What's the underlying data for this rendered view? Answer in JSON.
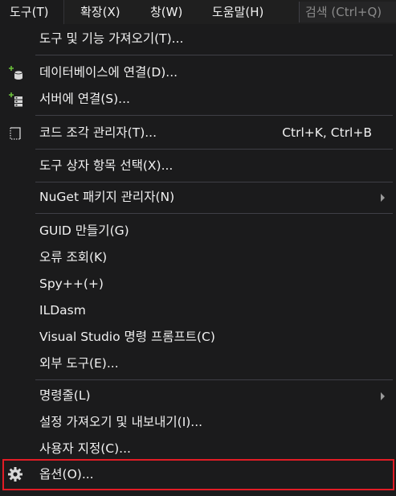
{
  "menubar": {
    "items": [
      {
        "label": "도구(T)"
      },
      {
        "label": "확장(X)"
      },
      {
        "label": "창(W)"
      },
      {
        "label": "도움말(H)"
      }
    ],
    "search_placeholder": "검색 (Ctrl+Q)"
  },
  "menu": {
    "items": [
      {
        "label": "도구 및 기능 가져오기(T)..."
      },
      {
        "label": "데이터베이스에 연결(D)...",
        "icon": "database-connect-icon"
      },
      {
        "label": "서버에 연결(S)...",
        "icon": "server-connect-icon"
      },
      {
        "label": "코드 조각 관리자(T)...",
        "shortcut": "Ctrl+K, Ctrl+B",
        "icon": "code-snippet-icon"
      },
      {
        "label": "도구 상자 항목 선택(X)..."
      },
      {
        "label": "NuGet 패키지 관리자(N)",
        "submenu": true
      },
      {
        "label": "GUID 만들기(G)"
      },
      {
        "label": "오류 조회(K)"
      },
      {
        "label": "Spy++(+)"
      },
      {
        "label": "ILDasm"
      },
      {
        "label": "Visual Studio 명령 프롬프트(C)"
      },
      {
        "label": "외부 도구(E)..."
      },
      {
        "label": "명령줄(L)",
        "submenu": true
      },
      {
        "label": "설정 가져오기 및 내보내기(I)..."
      },
      {
        "label": "사용자 지정(C)..."
      },
      {
        "label": "옵션(O)...",
        "icon": "gear-icon"
      }
    ]
  },
  "colors": {
    "menu_background": "#1b1b1c",
    "text": "#f1f1f1",
    "separator": "#3f3f46",
    "highlight_border": "#e21c25",
    "icon_green": "#6bbf3b"
  }
}
